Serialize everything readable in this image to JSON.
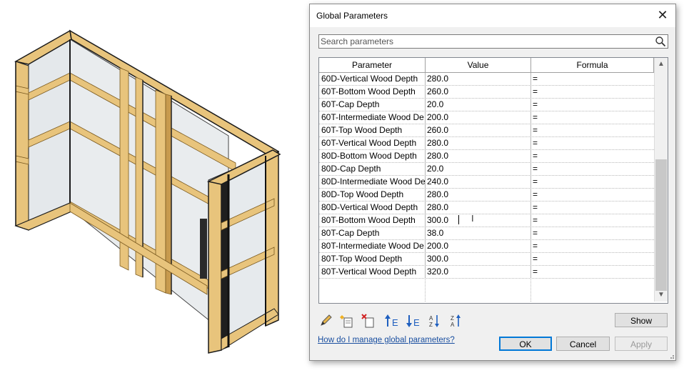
{
  "dialog": {
    "title": "Global Parameters",
    "close_glyph": "✕",
    "search": {
      "placeholder": "Search parameters",
      "value": ""
    },
    "columns": {
      "parameter": "Parameter",
      "value": "Value",
      "formula": "Formula"
    },
    "rows": [
      {
        "parameter": "60D-Vertical Wood Depth",
        "value": "280.0",
        "formula": "="
      },
      {
        "parameter": "60T-Bottom Wood Depth",
        "value": "260.0",
        "formula": "="
      },
      {
        "parameter": "60T-Cap Depth",
        "value": "20.0",
        "formula": "="
      },
      {
        "parameter": "60T-Intermediate Wood De",
        "value": "200.0",
        "formula": "="
      },
      {
        "parameter": "60T-Top Wood Depth",
        "value": "260.0",
        "formula": "="
      },
      {
        "parameter": "60T-Vertical Wood Depth",
        "value": "280.0",
        "formula": "="
      },
      {
        "parameter": "80D-Bottom Wood Depth",
        "value": "280.0",
        "formula": "="
      },
      {
        "parameter": "80D-Cap Depth",
        "value": "20.0",
        "formula": "="
      },
      {
        "parameter": "80D-Intermediate Wood De",
        "value": "240.0",
        "formula": "="
      },
      {
        "parameter": "80D-Top Wood Depth",
        "value": "280.0",
        "formula": "="
      },
      {
        "parameter": "80D-Vertical Wood Depth",
        "value": "280.0",
        "formula": "="
      },
      {
        "parameter": "80T-Bottom Wood Depth",
        "value": "300.0",
        "formula": "="
      },
      {
        "parameter": "80T-Cap Depth",
        "value": "38.0",
        "formula": "="
      },
      {
        "parameter": "80T-Intermediate Wood De",
        "value": "200.0",
        "formula": "="
      },
      {
        "parameter": "80T-Top Wood Depth",
        "value": "300.0",
        "formula": "="
      },
      {
        "parameter": "80T-Vertical Wood Depth",
        "value": "320.0",
        "formula": "="
      }
    ],
    "toolbar_icons": [
      "edit-pencil-icon",
      "new-parameter-icon",
      "delete-parameter-icon",
      "move-up-icon",
      "move-down-icon",
      "sort-ascending-icon",
      "sort-descending-icon"
    ],
    "help_link": "How do I manage global parameters?",
    "buttons": {
      "show": "Show",
      "ok": "OK",
      "cancel": "Cancel",
      "apply": "Apply"
    }
  },
  "colors": {
    "wood": "#e8c47c",
    "wood_dark": "#c79a4e",
    "frame_black": "#1a1a1a",
    "glass": "#dfe3e6",
    "link": "#1a4fa0",
    "ok_border": "#0078d7"
  }
}
